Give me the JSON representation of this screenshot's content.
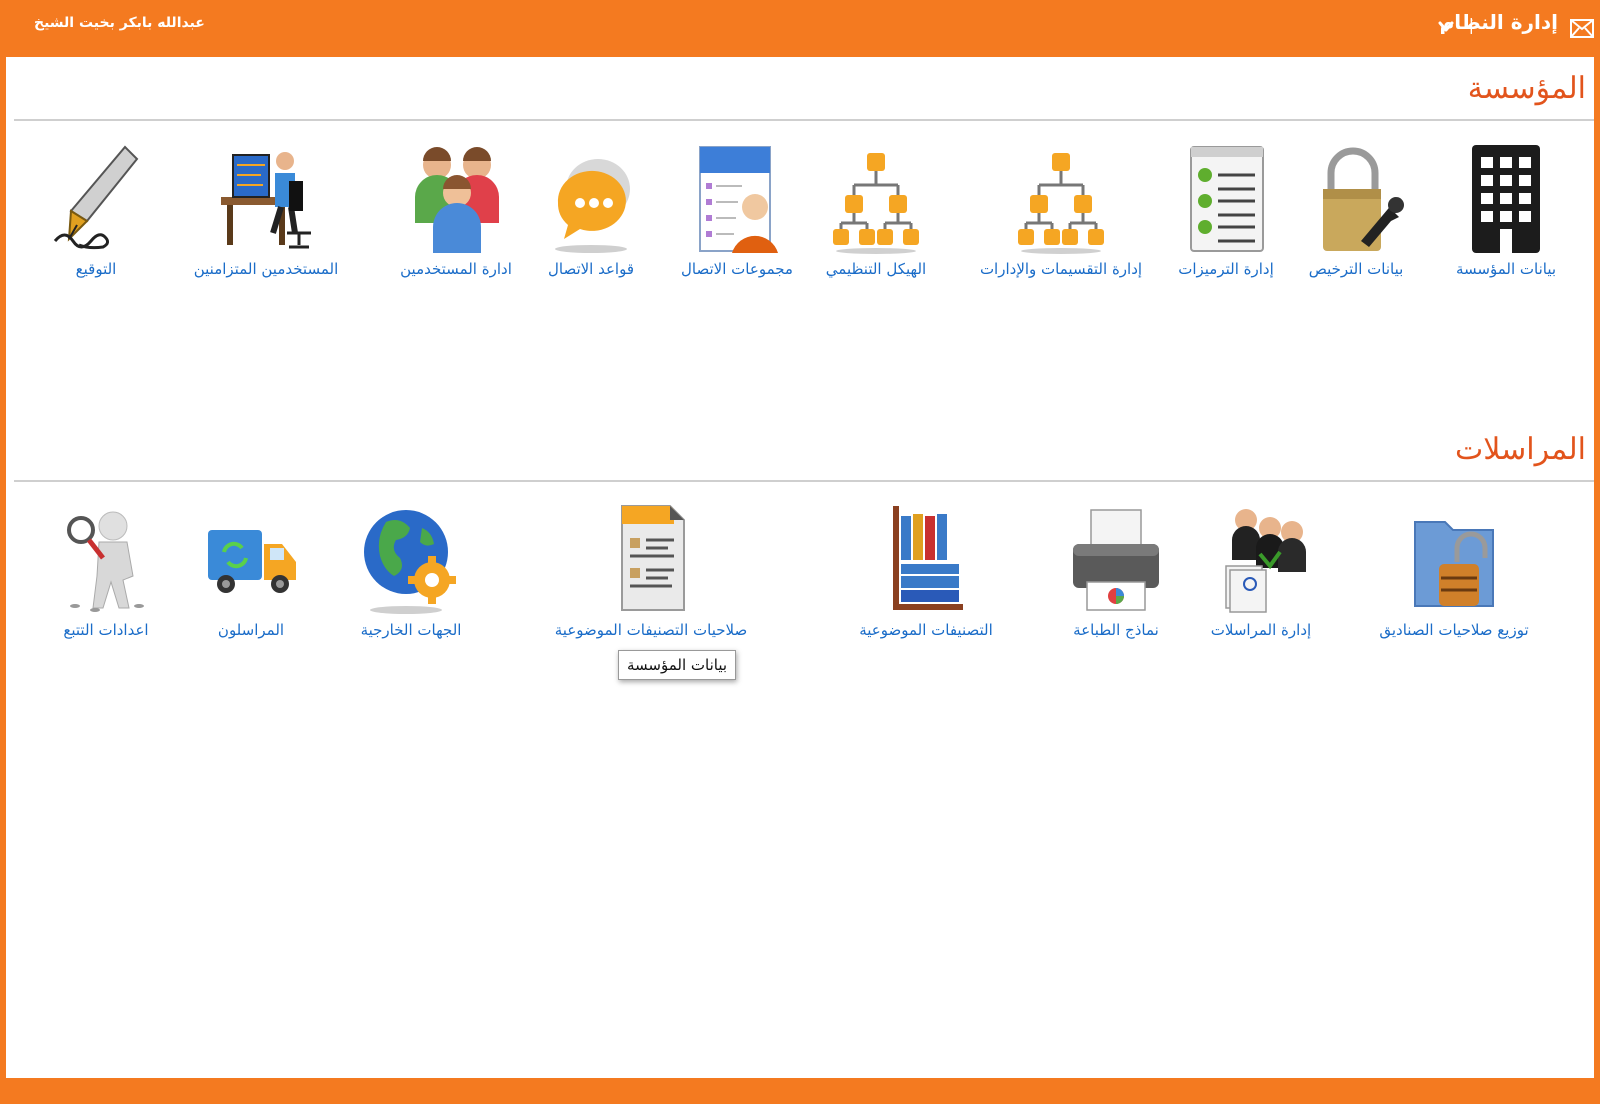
{
  "header": {
    "title": "إدارة النظام",
    "separator": "|",
    "user_name": "عبدالله بابكر بخيت الشيخ",
    "mail_icon": "envelope-icon",
    "menu_icon": "chevron-down-icon"
  },
  "colors": {
    "brand": "#f47a20",
    "section_title": "#e2541c",
    "link": "#1a6cc8"
  },
  "sections": [
    {
      "title": "المؤسسة",
      "items": [
        {
          "label": "بيانات المؤسسة",
          "icon": "building-icon"
        },
        {
          "label": "بيانات الترخيص",
          "icon": "padlock-key-icon"
        },
        {
          "label": "إدارة الترميزات",
          "icon": "checklist-icon"
        },
        {
          "label": "إدارة التقسيمات والإدارات",
          "icon": "org-tree-icon"
        },
        {
          "label": "الهيكل التنظيمي",
          "icon": "org-chart-icon"
        },
        {
          "label": "مجموعات الاتصال",
          "icon": "contact-card-icon"
        },
        {
          "label": "قواعد الاتصال",
          "icon": "chat-bubble-icon"
        },
        {
          "label": "ادارة المستخدمين",
          "icon": "users-icon"
        },
        {
          "label": "المستخدمين المتزامنين",
          "icon": "user-at-desk-icon"
        },
        {
          "label": "التوقيع",
          "icon": "fountain-pen-icon"
        }
      ]
    },
    {
      "title": "المراسلات",
      "items": [
        {
          "label": "توزيع صلاحيات الصناديق",
          "icon": "locked-folder-icon"
        },
        {
          "label": "إدارة المراسلات",
          "icon": "staff-documents-icon"
        },
        {
          "label": "نماذج الطباعة",
          "icon": "printer-icon"
        },
        {
          "label": "التصنيفات الموضوعية",
          "icon": "bookshelf-icon"
        },
        {
          "label": "صلاحيات التصنيفات الموضوعية",
          "icon": "document-icon"
        },
        {
          "label": "الجهات الخارجية",
          "icon": "globe-gear-icon"
        },
        {
          "label": "المراسلون",
          "icon": "delivery-truck-icon"
        },
        {
          "label": "اعدادات التتبع",
          "icon": "magnifier-person-icon"
        }
      ]
    }
  ],
  "tooltip": {
    "text": "بيانات المؤسسة"
  }
}
